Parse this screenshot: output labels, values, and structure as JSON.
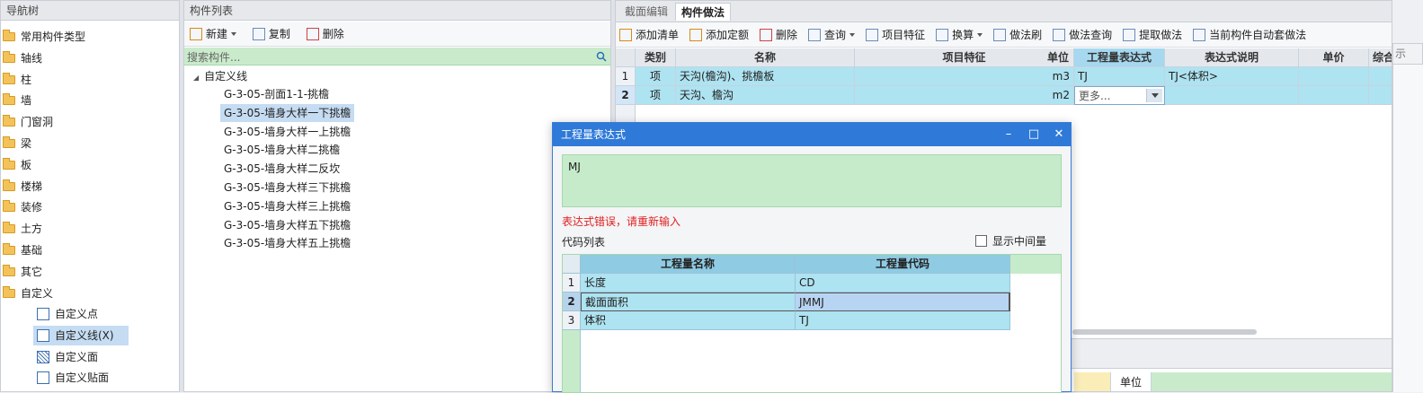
{
  "nav": {
    "header": "导航树",
    "items": [
      "常用构件类型",
      "轴线",
      "柱",
      "墙",
      "门窗洞",
      "梁",
      "板",
      "楼梯",
      "装修",
      "土方",
      "基础",
      "其它",
      "自定义"
    ],
    "sub_items": [
      "自定义点",
      "自定义线(X)",
      "自定义面",
      "自定义贴面"
    ]
  },
  "component_list": {
    "header": "构件列表",
    "toolbar": {
      "new": "新建",
      "copy": "复制",
      "delete": "删除"
    },
    "search_placeholder": "搜索构件...",
    "root": "自定义线",
    "items": [
      "G-3-05-剖面1-1-挑檐",
      "G-3-05-墙身大样一下挑檐",
      "G-3-05-墙身大样一上挑檐",
      "G-3-05-墙身大样二挑檐",
      "G-3-05-墙身大样二反坎",
      "G-3-05-墙身大样三下挑檐",
      "G-3-05-墙身大样三上挑檐",
      "G-3-05-墙身大样五下挑檐",
      "G-3-05-墙身大样五上挑檐"
    ]
  },
  "right": {
    "tabs": [
      "截面编辑",
      "构件做法"
    ],
    "toolbar": [
      "添加清单",
      "添加定额",
      "删除",
      "查询",
      "项目特征",
      "换算",
      "做法刷",
      "做法查询",
      "提取做法",
      "当前构件自动套做法"
    ],
    "columns": [
      "类别",
      "名称",
      "项目特征",
      "单位",
      "工程量表达式",
      "表达式说明",
      "单价",
      "综合"
    ],
    "rows": [
      {
        "num": "1",
        "type": "项",
        "name": "天沟(檐沟)、挑檐板",
        "feature": "",
        "unit": "m3",
        "expr": "TJ",
        "desc": "TJ<体积>"
      },
      {
        "num": "2",
        "type": "项",
        "name": "天沟、檐沟",
        "feature": "",
        "unit": "m2",
        "expr": "更多...",
        "desc": ""
      }
    ],
    "side_tab": "示",
    "bottom_col": "单位"
  },
  "dialog": {
    "title": "工程量表达式",
    "controls": {
      "minimize": "–",
      "maximize": "□",
      "close": "✕"
    },
    "expression": "MJ",
    "error": "表达式错误，请重新输入",
    "code_list_label": "代码列表",
    "show_intermediate": "显示中间量",
    "columns": [
      "工程量名称",
      "工程量代码"
    ],
    "rows": [
      {
        "num": "1",
        "name": "长度",
        "code": "CD"
      },
      {
        "num": "2",
        "name": "截面面积",
        "code": "JMMJ"
      },
      {
        "num": "3",
        "name": "体积",
        "code": "TJ"
      }
    ]
  }
}
